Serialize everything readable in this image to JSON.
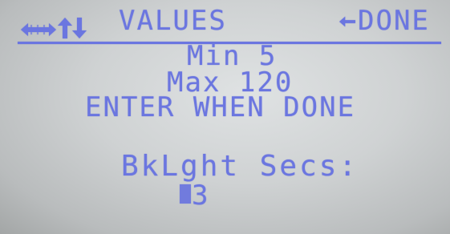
{
  "header": {
    "title": "VALUES",
    "done_label": "DONE",
    "icons": [
      "left-right-arrow-icon",
      "up-arrow-icon",
      "down-arrow-icon",
      "enter-arrow-icon"
    ]
  },
  "body": {
    "min_text": "Min 5",
    "max_text": "Max 120",
    "instruction": "ENTER WHEN DONE",
    "field_label": "BkLght Secs:",
    "field_value": "3"
  },
  "colors": {
    "lcd_text": "#6b76e0",
    "lcd_background": "#cfd2d3"
  }
}
